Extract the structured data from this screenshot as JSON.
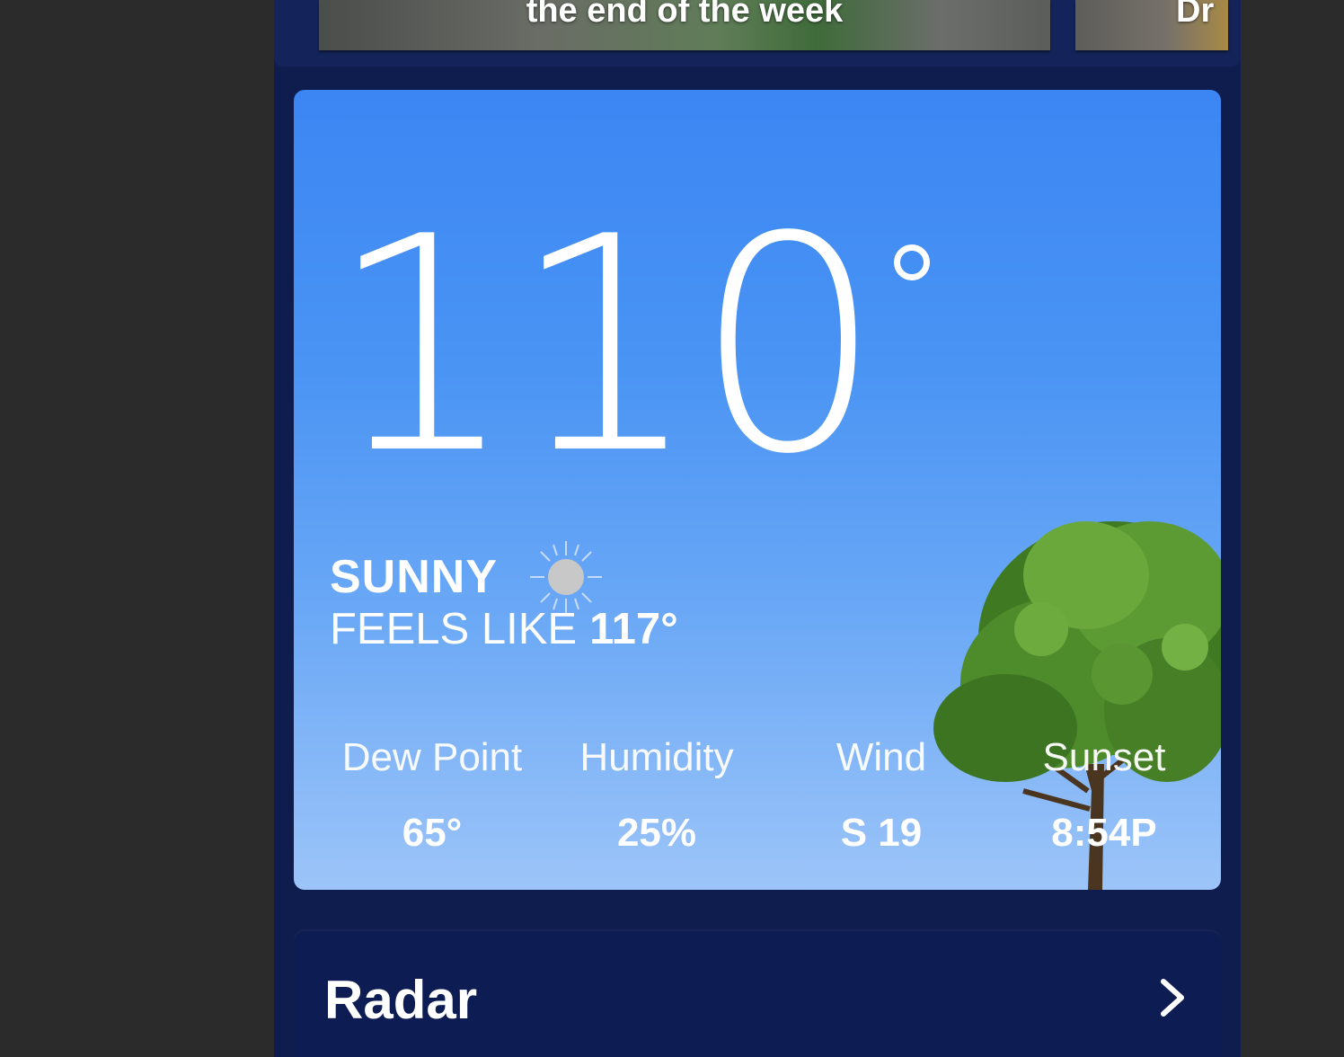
{
  "news": {
    "cards": [
      {
        "caption": "the end of the week"
      },
      {
        "caption": "Dr"
      }
    ]
  },
  "current": {
    "temperature": "110",
    "condition": "SUNNY",
    "condition_icon": "sun-icon",
    "feels_like_label": "FEELS LIKE",
    "feels_like_value": "117°"
  },
  "details": [
    {
      "label": "Dew Point",
      "value": "65°"
    },
    {
      "label": "Humidity",
      "value": "25%"
    },
    {
      "label": "Wind",
      "value": "S 19"
    },
    {
      "label": "Sunset",
      "value": "8:54P"
    }
  ],
  "radar": {
    "label": "Radar",
    "icon": "chevron-right-icon"
  },
  "colors": {
    "app_background": "#0f1d4e",
    "card_sky_top": "#3b86f3",
    "card_sky_bottom": "#9cc4f8",
    "outer_background": "#2b2b2b"
  }
}
